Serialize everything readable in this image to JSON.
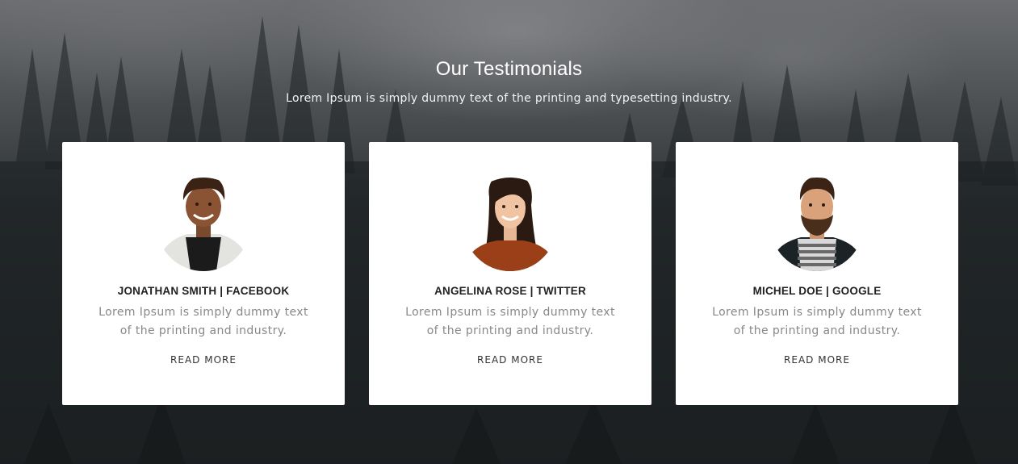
{
  "section": {
    "title": "Our Testimonials",
    "subtitle": "Lorem Ipsum is simply dummy text of the printing and typesetting industry."
  },
  "testimonials": [
    {
      "name": "JONATHAN SMITH | FACEBOOK",
      "text": "Lorem Ipsum is simply dummy text of the printing and industry.",
      "link": "READ MORE",
      "avatar_icon": "person-avatar-jonathan"
    },
    {
      "name": "ANGELINA ROSE | TWITTER",
      "text": "Lorem Ipsum is simply dummy text of the printing and industry.",
      "link": "READ MORE",
      "avatar_icon": "person-avatar-angelina"
    },
    {
      "name": "MICHEL DOE | GOOGLE",
      "text": "Lorem Ipsum is simply dummy text of the printing and industry.",
      "link": "READ MORE",
      "avatar_icon": "person-avatar-michel"
    }
  ],
  "colors": {
    "card_background": "#ffffff",
    "title_color": "#ffffff",
    "name_color": "#222222",
    "body_text_color": "#888888"
  }
}
